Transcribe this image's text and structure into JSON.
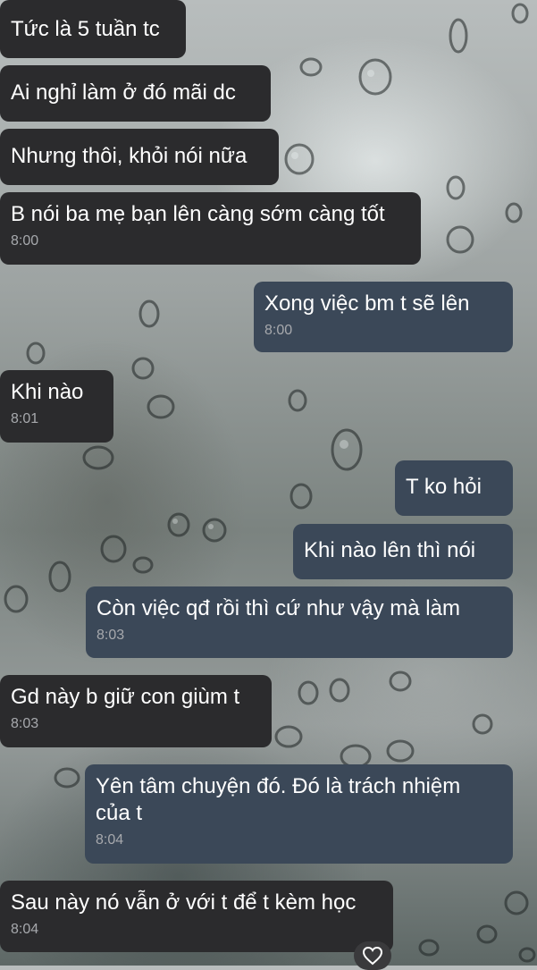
{
  "wallpaper": {
    "description_icon": "raindrops-on-window"
  },
  "colors": {
    "received_bubble": "#2b2b2d",
    "sent_bubble": "#3b4858",
    "timestamp": "#a7a9ad",
    "text": "#ffffff"
  },
  "messages": [
    {
      "side": "received",
      "text": "Tức là 5 tuần tc",
      "time": null
    },
    {
      "side": "received",
      "text": "Ai nghỉ làm ở đó mãi dc",
      "time": null
    },
    {
      "side": "received",
      "text": "Nhưng thôi, khỏi nói nữa",
      "time": null
    },
    {
      "side": "received",
      "text": "B nói ba mẹ bạn lên càng sớm càng tốt",
      "time": "8:00"
    },
    {
      "side": "sent",
      "text": "Xong việc bm t sẽ lên",
      "time": "8:00"
    },
    {
      "side": "received",
      "text": "Khi nào",
      "time": "8:01"
    },
    {
      "side": "sent",
      "text": "T ko hỏi",
      "time": null
    },
    {
      "side": "sent",
      "text": "Khi nào lên thì nói",
      "time": null
    },
    {
      "side": "sent",
      "text": "Còn việc qđ rồi thì cứ như vậy mà làm",
      "time": "8:03"
    },
    {
      "side": "received",
      "text": "Gd này b giữ con giùm t",
      "time": "8:03"
    },
    {
      "side": "sent",
      "text": "Yên tâm chuyện đó. Đó là trách nhiệm của t",
      "time": "8:04"
    },
    {
      "side": "received",
      "text": "Sau này nó vẫn ở với t để t kèm học",
      "time": "8:04"
    }
  ],
  "reaction": {
    "icon": "heart-outline-icon"
  }
}
